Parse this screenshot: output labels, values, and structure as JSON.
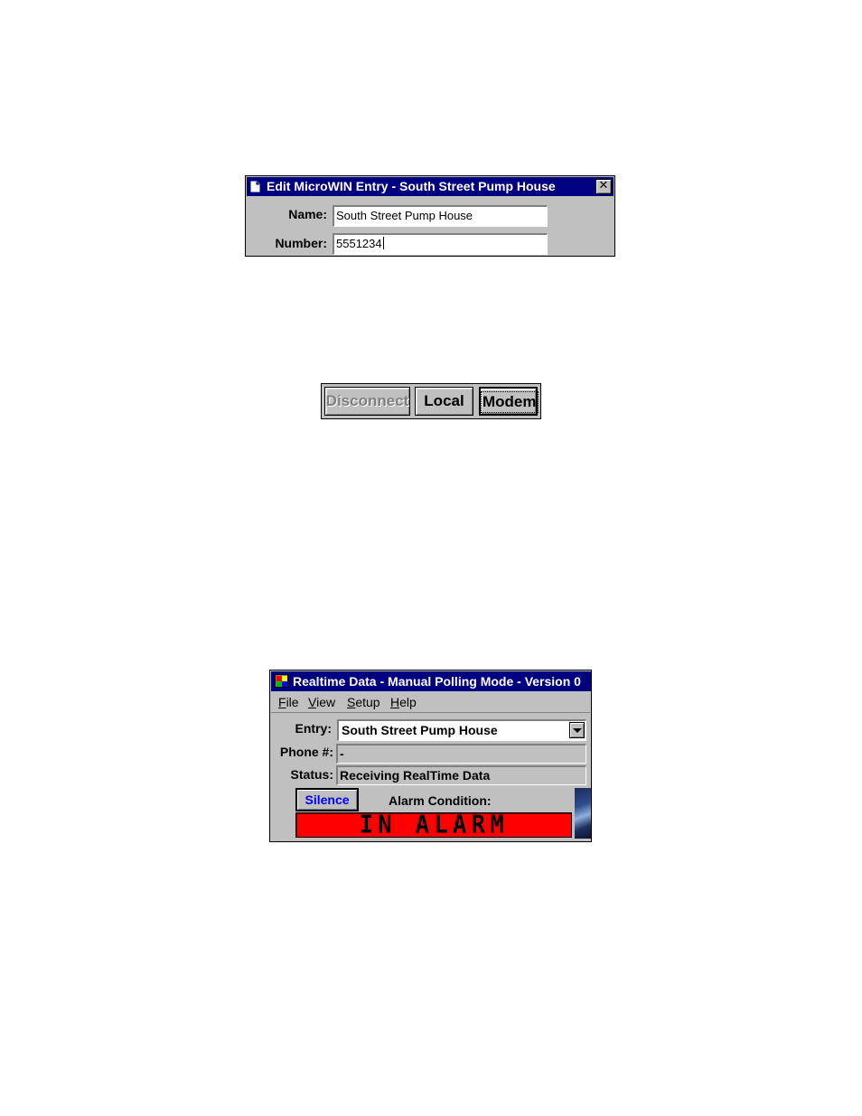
{
  "edit_dialog": {
    "title": "Edit MicroWIN Entry - South Street Pump House",
    "close_glyph": "✕",
    "name_label": "Name:",
    "name_value": "South Street Pump House",
    "number_label": "Number:",
    "number_value": "5551234"
  },
  "connection_buttons": {
    "disconnect_label": "Disconnect",
    "local_label": "Local",
    "modem_label": "Modem"
  },
  "realtime_window": {
    "title": "Realtime Data - Manual Polling Mode - Version 0",
    "menu": {
      "file_hotkey": "F",
      "file_rest": "ile",
      "view_hotkey": "V",
      "view_rest": "iew",
      "setup_hotkey": "S",
      "setup_rest": "etup",
      "help_hotkey": "H",
      "help_rest": "elp"
    },
    "entry_label": "Entry:",
    "entry_value": "South Street Pump House",
    "phone_label": "Phone #:",
    "phone_value": "-",
    "status_label": "Status:",
    "status_value": "Receiving RealTime Data",
    "silence_label": "Silence",
    "alarm_condition_label": "Alarm Condition:",
    "alarm_value": "IN ALARM"
  },
  "colors": {
    "titlebar": "#000080",
    "face": "#c0c0c0",
    "alarm_bg": "#ff0000",
    "silence_text": "#0000ff"
  },
  "icons": {
    "edit_dialog_icon": "document-icon",
    "realtime_app_icon": "app-grid-icon",
    "dropdown_arrow": "chevron-down-icon"
  }
}
